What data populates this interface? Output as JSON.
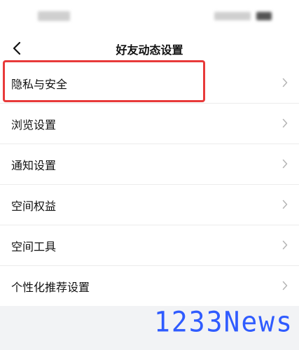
{
  "status_bar": {},
  "header": {
    "title": "好友动态设置"
  },
  "menu": {
    "items": [
      {
        "label": "隐私与安全"
      },
      {
        "label": "浏览设置"
      },
      {
        "label": "通知设置"
      },
      {
        "label": "空间权益"
      },
      {
        "label": "空间工具"
      },
      {
        "label": "个性化推荐设置"
      }
    ]
  },
  "icons": {
    "back": "chevron-left-icon",
    "item_arrow": "chevron-right-icon"
  },
  "colors": {
    "highlight": "#e83a3a",
    "watermark": "#2f5bff",
    "background": "#f2f3f5"
  },
  "watermark": {
    "text": "1233News"
  }
}
